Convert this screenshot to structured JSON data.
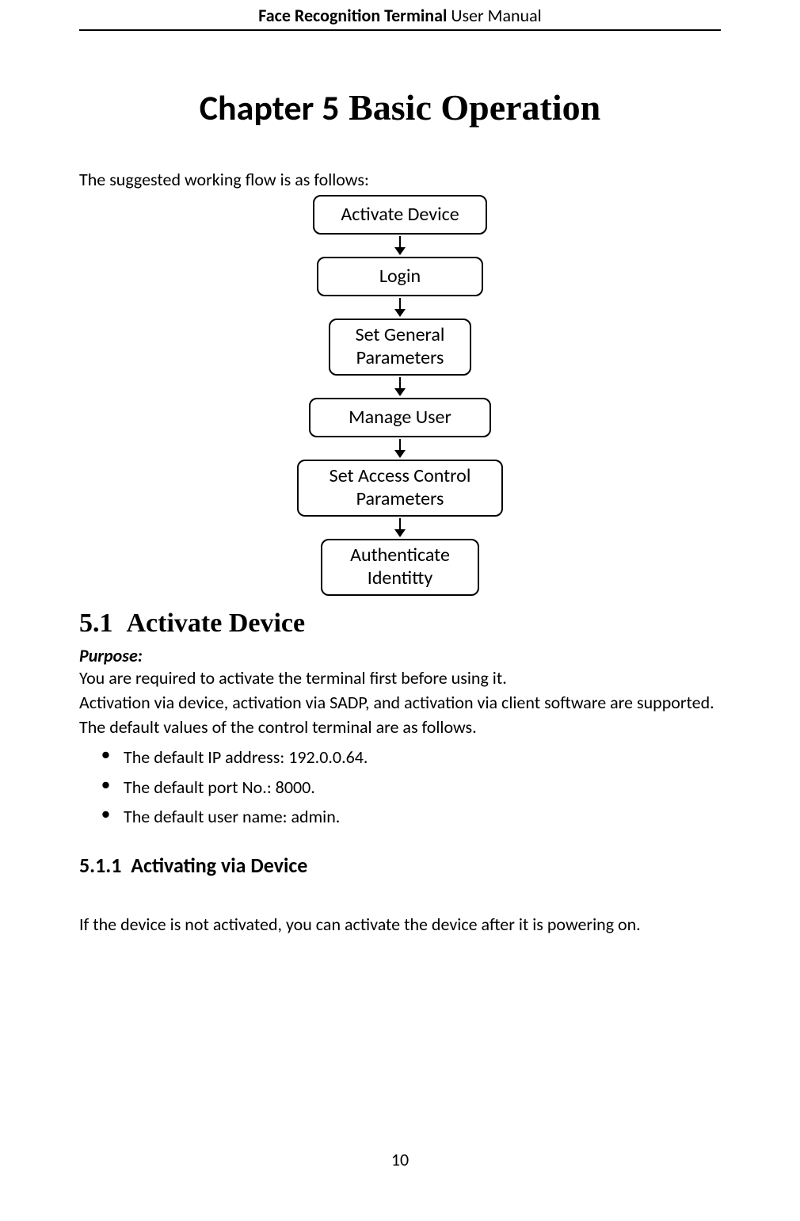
{
  "header": {
    "bold": "Face Recognition Terminal",
    "regular": "  User Manual"
  },
  "chapter": {
    "part1": "Chapter 5",
    "part2": " Basic Operation"
  },
  "intro": "The suggested working flow is as follows:",
  "flow": {
    "box1": "Activate Device",
    "box2": "Login",
    "box3": "Set General Parameters",
    "box4": "Manage User",
    "box5": "Set Access Control Parameters",
    "box6": "Authenticate Identitty"
  },
  "section": {
    "num": "5.1",
    "title": "Activate Device"
  },
  "purpose_label": "Purpose:",
  "para1": "You are required to activate the terminal first before using it.",
  "para2": "Activation via device, activation via SADP, and activation via client software are supported.",
  "para3": "The default values of the control terminal are as follows.",
  "bullets": {
    "b1": "The default IP address: 192.0.0.64.",
    "b2": "The default port No.: 8000.",
    "b3": "The default user name: admin."
  },
  "subsection": {
    "num": "5.1.1",
    "title": "Activating via Device"
  },
  "para4": "If the device is not activated, you can activate the device after it is powering on.",
  "page_number": "10"
}
